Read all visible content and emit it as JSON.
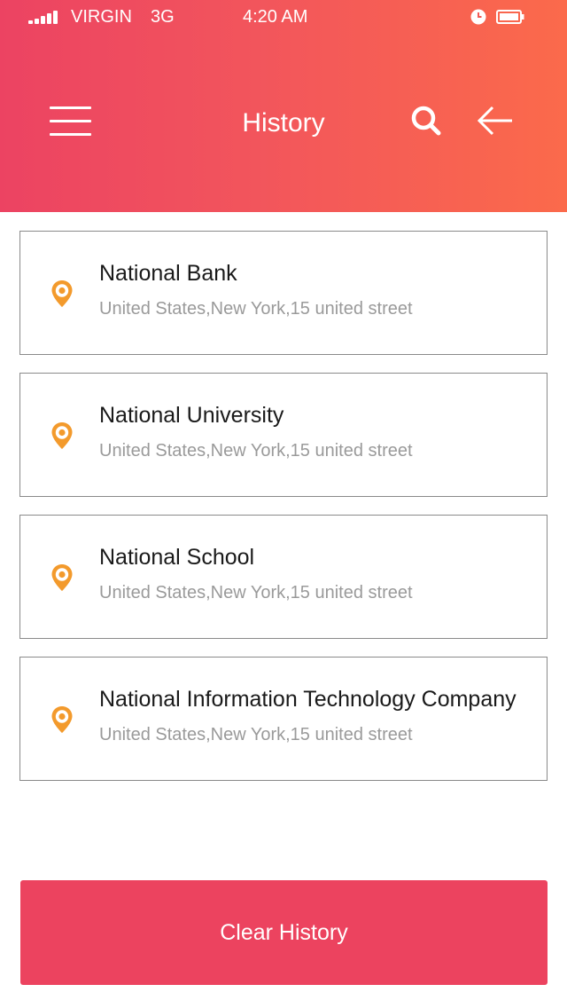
{
  "status_bar": {
    "carrier": "VIRGIN",
    "network": "3G",
    "time": "4:20 AM",
    "icons": [
      "signal-icon",
      "alarm-icon",
      "battery-icon"
    ]
  },
  "header": {
    "title": "History",
    "icons": [
      "menu-icon",
      "search-icon",
      "back-arrow-icon"
    ]
  },
  "history": [
    {
      "name": "National Bank",
      "address": "United States,New York,15 united street"
    },
    {
      "name": "National University",
      "address": "United States,New York,15 united street"
    },
    {
      "name": "National School",
      "address": "United States,New York,15 united street"
    },
    {
      "name": "National Information Technology Company",
      "address": "United States,New York,15 united street"
    }
  ],
  "footer": {
    "clear_label": "Clear History"
  },
  "colors": {
    "gradient_start": "#ec4362",
    "gradient_end": "#fb6a4b",
    "pin": "#f39a2c",
    "button": "#ec435f"
  }
}
